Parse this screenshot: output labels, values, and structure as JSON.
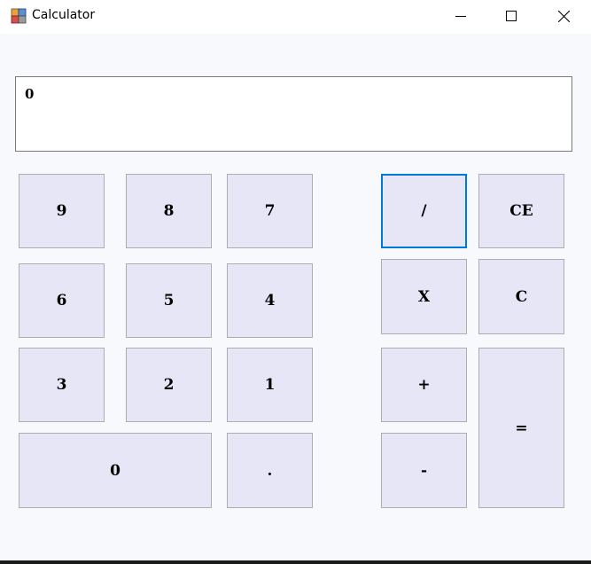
{
  "window": {
    "title": "Calculator",
    "icon": "app-window-icon",
    "controls": [
      "minimize-icon",
      "maximize-icon",
      "close-icon"
    ]
  },
  "display": {
    "value": "0"
  },
  "keys": {
    "k9": "9",
    "k8": "8",
    "k7": "7",
    "k6": "6",
    "k5": "5",
    "k4": "4",
    "k3": "3",
    "k2": "2",
    "k1": "1",
    "k0": "0",
    "dot": ".",
    "divide": "/",
    "ce": "CE",
    "multiply": "X",
    "clear": "C",
    "plus": "+",
    "minus": "-",
    "equals": "="
  },
  "colors": {
    "key_bg": "#e6e6f6",
    "focus_border": "#0078d7",
    "window_bg": "#f8f9fd"
  }
}
